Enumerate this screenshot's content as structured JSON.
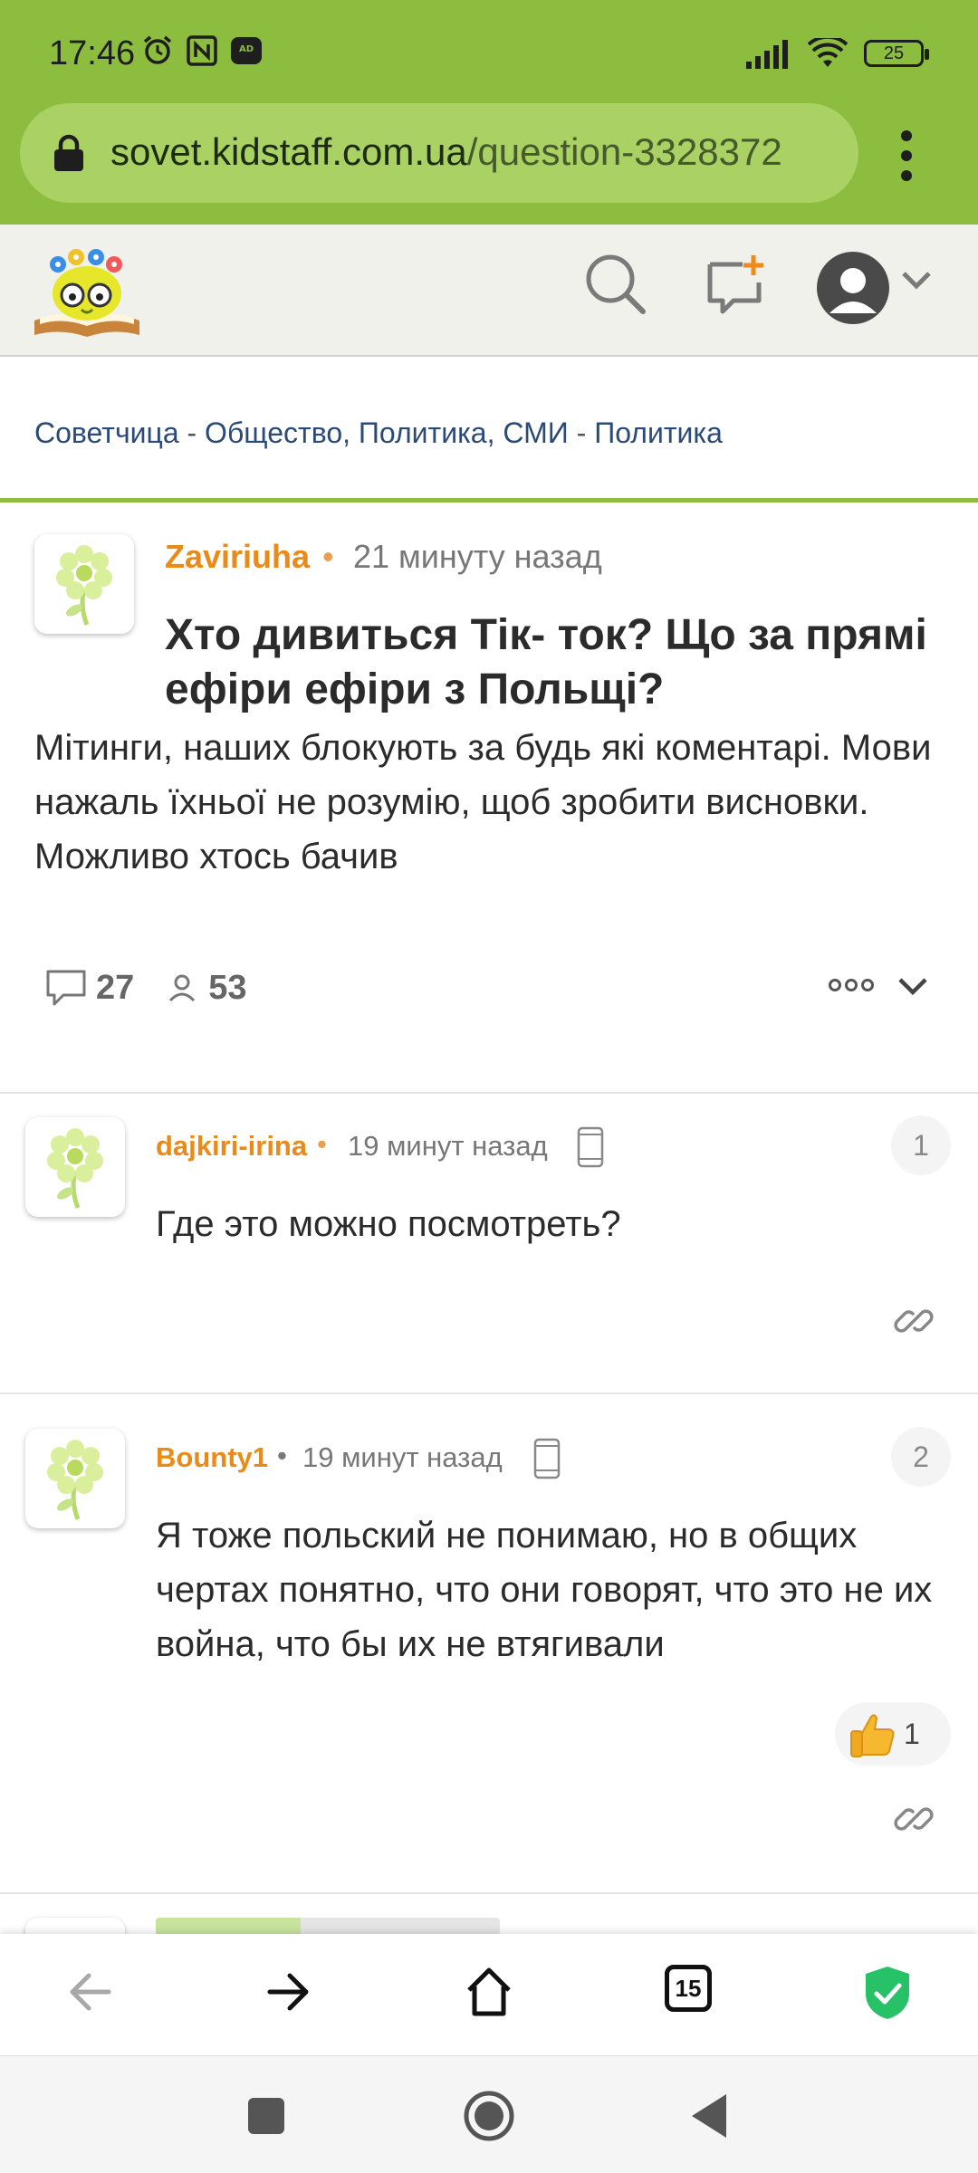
{
  "status_bar": {
    "time": "17:46",
    "battery": "25",
    "icons_left": [
      "alarm-icon",
      "nfc-icon",
      "adblock-icon"
    ],
    "icons_right": [
      "signal-icon",
      "wifi-icon",
      "battery-icon"
    ]
  },
  "browser": {
    "url_domain": "sovet.kidstaff.com.ua",
    "url_path": "/question-3328372",
    "tab_count": "15"
  },
  "header": {
    "logo": "site-logo",
    "icons": [
      "search-icon",
      "ask-question-icon",
      "user-avatar-icon",
      "chevron-down-icon"
    ]
  },
  "breadcrumb": {
    "items": [
      "Советчица",
      "Общество, Политика, СМИ",
      "Политика"
    ],
    "separator": " - "
  },
  "question": {
    "author": "Zaviriuha",
    "time": "21 минуту назад",
    "title": "Хто дивиться Тік- ток? Що за прямі ефіри ефіри з Польщі?",
    "body": "Мітинги, наших блокують за будь які коментарі. Мови нажаль їхньої не розумію, щоб зробити висновки. Можливо хтось бачив",
    "comments_count": "27",
    "followers_count": "53"
  },
  "answers": [
    {
      "author": "dajkiri-irina",
      "time": "19 минут назад",
      "number": "1",
      "text": "Где это можно посмотреть?"
    },
    {
      "author": "Bounty1",
      "time": "19 минут назад",
      "number": "2",
      "text": "Я тоже польский не понимаю, но в общих чертах понятно, что они говорят, что это не их война, что бы их не втягивали",
      "likes": "1"
    }
  ],
  "colors": {
    "brand_green": "#8cbd3f",
    "author_orange": "#e88b1a",
    "link_blue": "#2b4a78"
  }
}
